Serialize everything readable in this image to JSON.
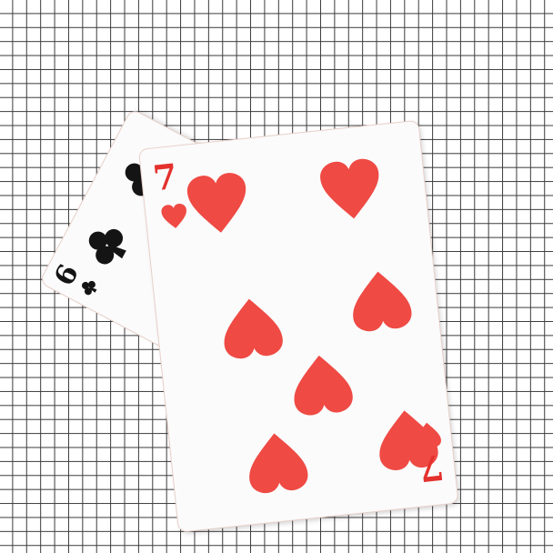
{
  "cards": [
    {
      "rank": "6",
      "suit": "clubs-icon",
      "color": "#141414"
    },
    {
      "rank": "7",
      "suit": "hearts-icon",
      "color": "#ef4a44"
    }
  ]
}
